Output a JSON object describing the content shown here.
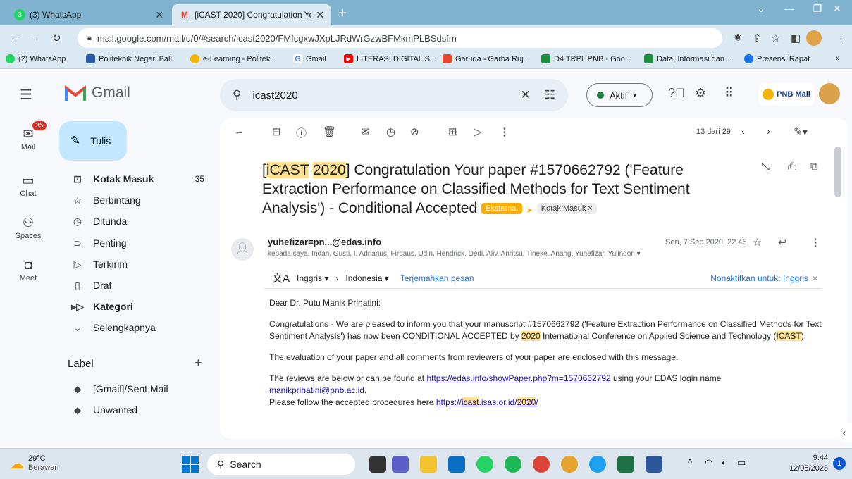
{
  "browser": {
    "tabs": [
      {
        "label": "(3) WhatsApp"
      },
      {
        "label": "[iCAST 2020] Congratulation You"
      }
    ],
    "url": "mail.google.com/mail/u/0/#search/icast2020/FMfcgxwJXpLJRdWrGzwBFMkmPLBSdsfm",
    "bookmarks": [
      "(2) WhatsApp",
      "Politeknik Negeri Bali",
      "e-Learning - Politek...",
      "Gmail",
      "LITERASI DIGITAL S...",
      "Garuda - Garba Ruj...",
      "D4 TRPL PNB - Goo...",
      "Data, Informasi dan...",
      "Presensi Rapat"
    ],
    "bookmark_icons": [
      "bm-whatsapp",
      "bm-pnb",
      "bm-elearning",
      "bm-google",
      "bm-youtube",
      "bm-garuda",
      "bm-drive",
      "bm-drive",
      "bm-meet"
    ],
    "chevron": "»"
  },
  "gmail": {
    "logo": "Gmail",
    "search_value": "icast2020",
    "status": "Aktif",
    "badge": "PNB Mail"
  },
  "rail": [
    {
      "label": "Mail",
      "badge": "35"
    },
    {
      "label": "Chat"
    },
    {
      "label": "Spaces"
    },
    {
      "label": "Meet"
    }
  ],
  "compose": "Tulis",
  "nav": [
    {
      "label": "Kotak Masuk",
      "count": "35",
      "icon": "inbox-icon"
    },
    {
      "label": "Berbintang",
      "icon": "star-icon"
    },
    {
      "label": "Ditunda",
      "icon": "clock-icon"
    },
    {
      "label": "Penting",
      "icon": "important-icon"
    },
    {
      "label": "Terkirim",
      "icon": "send-icon"
    },
    {
      "label": "Draf",
      "icon": "draft-icon"
    },
    {
      "label": "Kategori",
      "icon": "label-icon"
    },
    {
      "label": "Selengkapnya",
      "icon": "chevron-down-icon"
    }
  ],
  "labels_title": "Label",
  "labels": [
    "[Gmail]/Sent Mail",
    "Unwanted"
  ],
  "toolbar": {
    "pager": "13 dari 29"
  },
  "email": {
    "subject_hl1": "iCAST",
    "subject_hl2": "2020",
    "subject_rest": "] Congratulation Your paper #1570662792 ('Feature Extraction Performance on Classified Methods for Text Sentiment Analysis') - Conditional Accepted",
    "chip_external": "Eksternal",
    "chip_inbox": "Kotak Masuk",
    "sender": "yuhefizar=pn...@edas.info",
    "date": "Sen, 7 Sep 2020, 22.45",
    "recipients": "kepada saya, Indah, Gusti, I, Adrianus, Firdaus, Udin, Hendrick, Dedi, Aliv, Anritsu, Tineke, Anang, Yuhefizar, Yulindon",
    "translate": {
      "from": "Inggris",
      "to": "Indonesia",
      "action": "Terjemahkan pesan",
      "disable": "Nonaktifkan untuk: Inggris"
    },
    "greeting": "Dear Dr. Putu Manik Prihatini:",
    "para1_a": "Congratulations - We are pleased to inform you that your manuscript #1570662792 ('Feature Extraction Performance on Classified Methods for Text Sentiment Analysis') has now been CONDITIONAL ACCEPTED by ",
    "para1_hl": "2020",
    "para1_b": " International Conference on Applied Science and Technology (",
    "para1_hl2": "ICAST",
    "para1_c": ").",
    "para2": "The evaluation of your paper and all comments from reviewers of your paper are enclosed with this message.",
    "para3_a": "The reviews are below or can be found at ",
    "para3_link": "https://edas.info/showPaper.php?m=1570662792",
    "para3_b": " using your EDAS login name",
    "para3_email": "manikprihatini@pnb.ac.id",
    "para3_c": ".",
    "para4_a": "Please follow the accepted procedures here ",
    "para4_link_a": "https://",
    "para4_link_hl": "icast",
    "para4_link_b": ".isas.or.id/",
    "para4_link_hl2": "2020",
    "para4_link_c": "/"
  },
  "taskbar": {
    "weather_temp": "29°C",
    "weather_desc": "Berawan",
    "search": "Search",
    "time": "9:44",
    "date": "12/05/2023",
    "notif": "1"
  },
  "colors": {
    "accent": "#c2e7ff",
    "highlight": "#fde293",
    "link": "#1a0dab",
    "chrome": "#dbe9f3"
  }
}
